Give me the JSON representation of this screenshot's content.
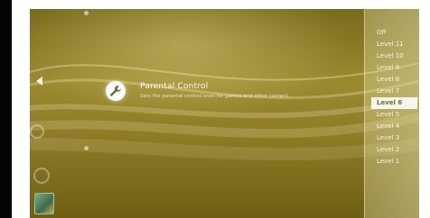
{
  "menu": {
    "selected_item": {
      "icon": "wrench-icon",
      "title": "Parental Control",
      "description": "Sets the parental control level for games and other content."
    },
    "column_icons": [
      "sphere-icon",
      "sphere-icon",
      "game-icon"
    ]
  },
  "level_options": {
    "items": [
      "Off",
      "Level 11",
      "Level 10",
      "Level 9",
      "Level 8",
      "Level 7",
      "Level 6",
      "Level 5",
      "Level 4",
      "Level 3",
      "Level 2",
      "Level 1"
    ],
    "selected": "Level 6"
  },
  "colors": {
    "theme_gold": "#8e7c26",
    "highlight": "#ffffff"
  }
}
